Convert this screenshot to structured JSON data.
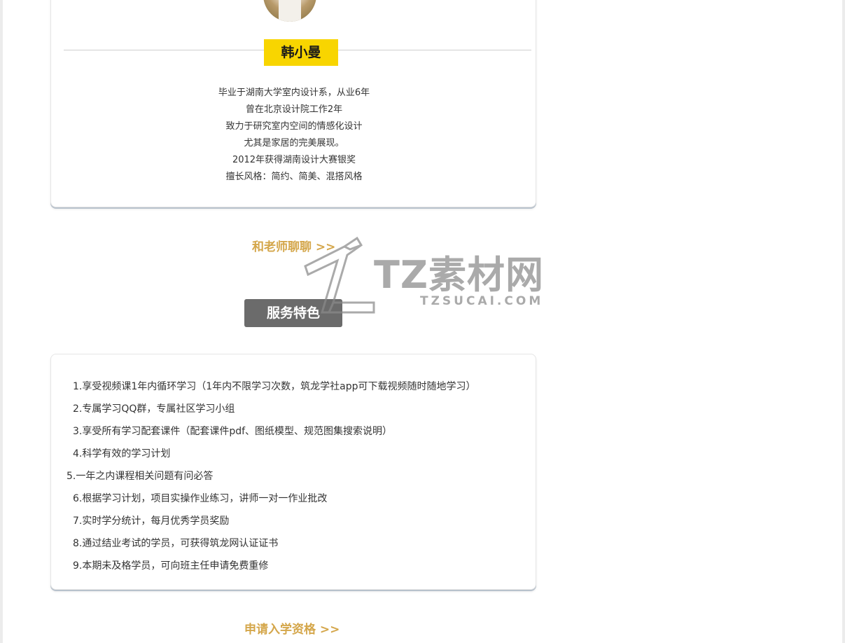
{
  "teacher": {
    "name": "韩小曼",
    "bio": [
      "毕业于湖南大学室内设计系，从业6年",
      "曾在北京设计院工作2年",
      "致力于研究室内空间的情感化设计",
      "尤其是家居的完美展现。",
      "2012年获得湖南设计大赛银奖",
      "擅长风格：简约、简美、混搭风格"
    ],
    "chat_link": "和老师聊聊 >>"
  },
  "services": {
    "title": "服务特色",
    "items": [
      "1.享受视频课1年内循环学习（1年内不限学习次数，筑龙学社app可下载视频随时随地学习）",
      "2.专属学习QQ群，专属社区学习小组",
      "3.享受所有学习配套课件（配套课件pdf、图纸模型、规范图集搜索说明）",
      "4.科学有效的学习计划",
      "5.一年之内课程相关问题有问必答",
      "6.根据学习计划，项目实操作业练习，讲师一对一作业批改",
      "7.实时学分统计，每月优秀学员奖励",
      "8.通过结业考试的学员，可获得筑龙网认证证书",
      "9.本期未及格学员，可向班主任申请免费重修"
    ],
    "apply_link": "申请入学资格  >>"
  },
  "watermark": {
    "brand": "TZ素材网",
    "domain": "TZSUCAI.COM"
  },
  "colors": {
    "accent_yellow": "#f8d500",
    "link_gold": "#d4a64a",
    "title_gray": "#6b6b6b"
  }
}
